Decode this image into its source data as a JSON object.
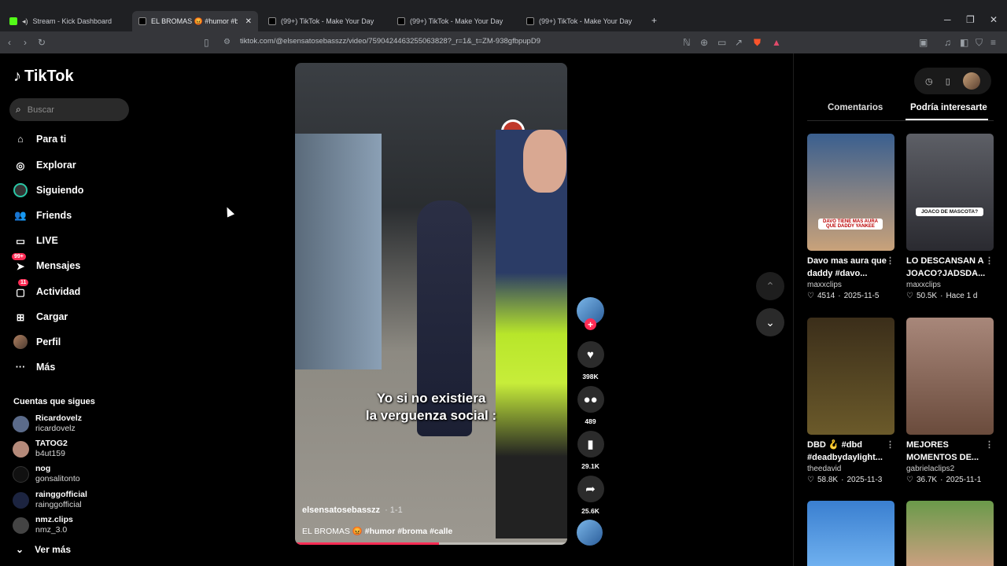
{
  "browser": {
    "tabs": [
      {
        "title": "Stream - Kick Dashboard",
        "icon": "kick-icon",
        "color": "#53fc18",
        "active": false
      },
      {
        "title": "EL BROMAS 😡 #humor #bro",
        "icon": "tiktok-icon",
        "color": "#ffffff",
        "active": true
      },
      {
        "title": "(99+) TikTok - Make Your Day",
        "icon": "tiktok-icon",
        "color": "#ffffff",
        "active": false
      },
      {
        "title": "(99+) TikTok - Make Your Day",
        "icon": "tiktok-icon",
        "color": "#ffffff",
        "active": false
      },
      {
        "title": "(99+) TikTok - Make Your Day",
        "icon": "tiktok-icon",
        "color": "#ffffff",
        "active": false
      }
    ],
    "url": "tiktok.com/@elsensatosebasszz/video/7590424463255063828?_r=1&_t=ZM-938gfbpupD9"
  },
  "sidebar": {
    "logo": "TikTok",
    "search_placeholder": "Buscar",
    "nav": [
      {
        "label": "Para ti",
        "icon": "home-icon"
      },
      {
        "label": "Explorar",
        "icon": "compass-icon"
      },
      {
        "label": "Siguiendo",
        "icon": "following-icon"
      },
      {
        "label": "Friends",
        "icon": "friends-icon"
      },
      {
        "label": "LIVE",
        "icon": "live-icon"
      },
      {
        "label": "Mensajes",
        "icon": "messages-icon",
        "badge": "99+"
      },
      {
        "label": "Actividad",
        "icon": "activity-icon",
        "badge": "11"
      },
      {
        "label": "Cargar",
        "icon": "upload-icon"
      },
      {
        "label": "Perfil",
        "icon": "profile-avatar"
      },
      {
        "label": "Más",
        "icon": "more-icon"
      }
    ],
    "following_title": "Cuentas que sigues",
    "following": [
      {
        "name": "Ricardovelz",
        "handle": "ricardovelz",
        "color": "#5b6b8a"
      },
      {
        "name": "TATOG2",
        "handle": "b4ut159",
        "color": "#b58a7a"
      },
      {
        "name": "nog",
        "handle": "gonsalitonto",
        "color": "#111111"
      },
      {
        "name": "rainggofficial",
        "handle": "rainggofficial",
        "color": "#1c2440"
      },
      {
        "name": "nmz.clips",
        "handle": "nmz_3.0",
        "color": "#444444"
      }
    ],
    "see_more": "Ver más"
  },
  "video": {
    "caption_line1": "Yo si no existiera",
    "caption_line2": "la verguenza social :",
    "username": "elsensatosebasszz",
    "date": "· 1-1",
    "description_prefix": "EL BROMAS 😡",
    "hashtags": "#humor #broma #calle",
    "progress": 0.53
  },
  "actions": {
    "likes": "398K",
    "comments": "489",
    "saves": "29.1K",
    "shares": "25.6K"
  },
  "right_panel": {
    "tab_comments": "Comentarios",
    "tab_recommended": "Podría interesarte",
    "cards": [
      {
        "title": "Davo mas aura que daddy #davo...",
        "author": "maxxclips",
        "likes": "4514",
        "date": "2025-11-5",
        "thumb_text": "DAVO TIENE MAS AURA QUE DADDY YANKEE",
        "c1": "#3a5f8f",
        "c2": "#c9a27a"
      },
      {
        "title": "LO DESCANSAN A JOACO?JADSDA...",
        "author": "maxxclips",
        "likes": "50.5K",
        "date": "Hace 1 d",
        "thumb_text": "JOACO DE MASCOTA?",
        "c1": "#2a2a30",
        "c2": "#5d5f66"
      },
      {
        "title": "DBD 🪝 #dbd #deadbydaylight...",
        "author": "theedavid",
        "likes": "58.8K",
        "date": "2025-11-3",
        "thumb_text": "",
        "c1": "#3b2e1a",
        "c2": "#6b5a2a"
      },
      {
        "title": "MEJORES MOMENTOS DE...",
        "author": "gabrielaclips2",
        "likes": "36.7K",
        "date": "2025-11-1",
        "thumb_text": "",
        "c1": "#6a4b3c",
        "c2": "#a8877a"
      },
      {
        "title": "",
        "author": "",
        "likes": "",
        "date": "",
        "thumb_text": "",
        "c1": "#3a7fd0",
        "c2": "#6fb0ef"
      },
      {
        "title": "",
        "author": "",
        "likes": "",
        "date": "",
        "thumb_text": "",
        "c1": "#6a9a4a",
        "c2": "#caa080"
      }
    ]
  }
}
